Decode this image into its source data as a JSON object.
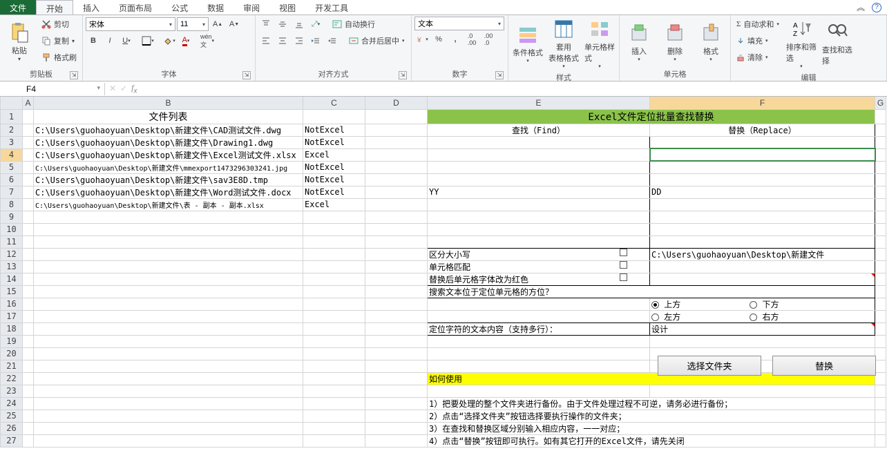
{
  "tabs": {
    "file": "文件",
    "home": "开始",
    "insert": "插入",
    "pageLayout": "页面布局",
    "formulas": "公式",
    "data": "数据",
    "review": "审阅",
    "view": "视图",
    "devTools": "开发工具"
  },
  "ribbon": {
    "clipboard": {
      "paste": "粘贴",
      "cut": "剪切",
      "copy": "复制",
      "formatPainter": "格式刷",
      "label": "剪贴板"
    },
    "font": {
      "name": "宋体",
      "size": "11",
      "label": "字体"
    },
    "alignment": {
      "wrap": "自动换行",
      "merge": "合并后居中",
      "label": "对齐方式"
    },
    "number": {
      "format": "文本",
      "label": "数字"
    },
    "styles": {
      "conditional": "条件格式",
      "tableFormat": "套用\n表格格式",
      "cellStyles": "单元格样式",
      "label": "样式"
    },
    "cells": {
      "insert": "插入",
      "delete": "删除",
      "format": "格式",
      "label": "单元格"
    },
    "editing": {
      "autosum": "自动求和",
      "fill": "填充",
      "clear": "清除",
      "sortFilter": "排序和筛选",
      "findSelect": "查找和选择",
      "label": "编辑"
    }
  },
  "nameBox": "F4",
  "columns": [
    "A",
    "B",
    "C",
    "D",
    "E",
    "F",
    "G"
  ],
  "activeCol": "F",
  "activeRow": 4,
  "cells": {
    "B1": "文件列表",
    "B2": "C:\\Users\\guohaoyuan\\Desktop\\新建文件\\CAD测试文件.dwg",
    "B3": "C:\\Users\\guohaoyuan\\Desktop\\新建文件\\Drawing1.dwg",
    "B4": "C:\\Users\\guohaoyuan\\Desktop\\新建文件\\Excel测试文件.xlsx",
    "B5": "C:\\Users\\guohaoyuan\\Desktop\\新建文件\\mmexport1473296303241.jpg",
    "B6": "C:\\Users\\guohaoyuan\\Desktop\\新建文件\\sav3E8D.tmp",
    "B7": "C:\\Users\\guohaoyuan\\Desktop\\新建文件\\Word测试文件.docx",
    "B8": "C:\\Users\\guohaoyuan\\Desktop\\新建文件\\表 - 副本 - 副本.xlsx",
    "C2": "NotExcel",
    "C3": "NotExcel",
    "C4": "Excel",
    "C5": "NotExcel",
    "C6": "NotExcel",
    "C7": "NotExcel",
    "C8": "Excel",
    "E1F1": "Excel文件定位批量查找替换",
    "E2": "查找（Find）",
    "F2": "替换（Replace）",
    "E7": "YY",
    "F7": "DD",
    "E12": "区分大小写",
    "E13": "单元格匹配",
    "E14": "替换后单元格字体改为红色",
    "F12": "C:\\Users\\guohaoyuan\\Desktop\\新建文件",
    "E15": "搜索文本位于定位单元格的方位？",
    "opt1": "上方",
    "opt2": "下方",
    "opt3": "左方",
    "opt4": "右方",
    "E18": "定位字符的文本内容（支持多行）：",
    "F18": "设计",
    "btnSelectFolder": "选择文件夹",
    "btnReplace": "替换",
    "E22": "如何使用",
    "E24": "1）把要处理的整个文件夹进行备份。由于文件处理过程不可逆，请务必进行备份；",
    "E25": "2）点击“选择文件夹”按钮选择要执行操作的文件夹；",
    "E26": "3）在查找和替换区域分别输入相应内容，一一对应；",
    "E27": "4）点击“替换”按钮即可执行。如有其它打开的Excel文件，请先关闭"
  }
}
